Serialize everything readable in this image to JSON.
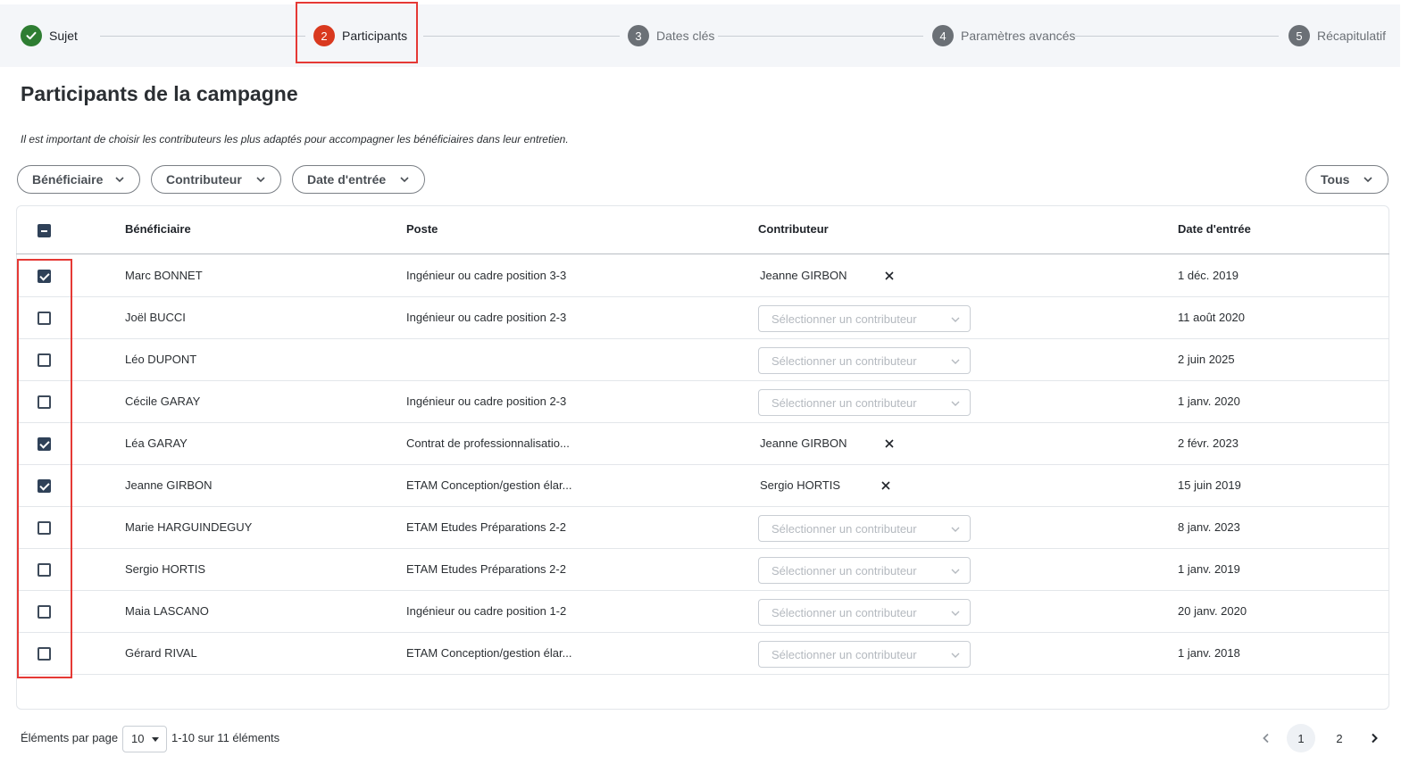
{
  "stepper": {
    "steps": [
      {
        "number": "1",
        "label": "Sujet",
        "state": "done"
      },
      {
        "number": "2",
        "label": "Participants",
        "state": "active"
      },
      {
        "number": "3",
        "label": "Dates clés",
        "state": "todo"
      },
      {
        "number": "4",
        "label": "Paramètres avancés",
        "state": "todo"
      },
      {
        "number": "5",
        "label": "Récapitulatif",
        "state": "todo"
      }
    ]
  },
  "page": {
    "title": "Participants de la campagne",
    "description": "Il est important de choisir les contributeurs les plus adaptés pour accompagner les bénéficiaires dans leur entretien."
  },
  "filters": {
    "beneficiaire": "Bénéficiaire",
    "contributeur": "Contributeur",
    "date_entree": "Date d'entrée",
    "status": "Tous"
  },
  "table": {
    "headers": {
      "beneficiaire": "Bénéficiaire",
      "poste": "Poste",
      "contributeur": "Contributeur",
      "date_entree": "Date d'entrée"
    },
    "select_placeholder": "Sélectionner un contributeur",
    "rows": [
      {
        "checked": true,
        "name": "Marc BONNET",
        "poste": "Ingénieur ou cadre position 3-3",
        "contributeur": "Jeanne GIRBON",
        "date": "1 déc. 2019"
      },
      {
        "checked": false,
        "name": "Joël BUCCI",
        "poste": "Ingénieur ou cadre position 2-3",
        "contributeur": "",
        "date": "11 août 2020"
      },
      {
        "checked": false,
        "name": "Léo DUPONT",
        "poste": "",
        "contributeur": "",
        "date": "2 juin 2025"
      },
      {
        "checked": false,
        "name": "Cécile GARAY",
        "poste": "Ingénieur ou cadre position 2-3",
        "contributeur": "",
        "date": "1 janv. 2020"
      },
      {
        "checked": true,
        "name": "Léa GARAY",
        "poste": "Contrat de professionnalisatio...",
        "contributeur": "Jeanne GIRBON",
        "date": "2 févr. 2023"
      },
      {
        "checked": true,
        "name": "Jeanne GIRBON",
        "poste": "ETAM Conception/gestion élar...",
        "contributeur": "Sergio HORTIS",
        "date": "15 juin 2019"
      },
      {
        "checked": false,
        "name": "Marie HARGUINDEGUY",
        "poste": "ETAM Etudes Préparations 2-2",
        "contributeur": "",
        "date": "8 janv. 2023"
      },
      {
        "checked": false,
        "name": "Sergio HORTIS",
        "poste": "ETAM Etudes Préparations 2-2",
        "contributeur": "",
        "date": "1 janv. 2019"
      },
      {
        "checked": false,
        "name": "Maia LASCANO",
        "poste": "Ingénieur ou cadre position 1-2",
        "contributeur": "",
        "date": "20 janv. 2020"
      },
      {
        "checked": false,
        "name": "Gérard RIVAL",
        "poste": "ETAM Conception/gestion élar...",
        "contributeur": "",
        "date": "1 janv. 2018"
      }
    ]
  },
  "footer": {
    "per_page_label": "Éléments par page",
    "per_page_value": "10",
    "range_text": "1-10 sur 11 éléments",
    "pages": [
      "1",
      "2"
    ],
    "current_page": "1"
  },
  "colors": {
    "done": "#2e7d32",
    "active": "#d9391f",
    "highlight": "#e53935",
    "checkbox": "#2f4158"
  }
}
